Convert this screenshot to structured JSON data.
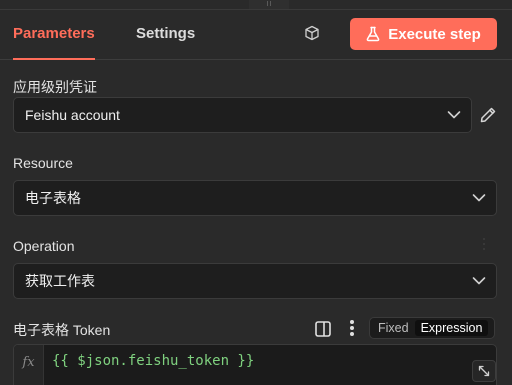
{
  "tabs": [
    {
      "label": "Parameters"
    },
    {
      "label": "Settings"
    }
  ],
  "execute_button": {
    "label": "Execute step"
  },
  "credential": {
    "label": "应用级别凭证",
    "value": "Feishu account"
  },
  "resource": {
    "label": "Resource",
    "value": "电子表格"
  },
  "operation": {
    "label": "Operation",
    "value": "获取工作表"
  },
  "token": {
    "label": "电子表格 Token",
    "mode_fixed": "Fixed",
    "mode_expression": "Expression",
    "active_mode": "Expression",
    "fx": "fx",
    "expression": "{{ $json.feishu_token }}"
  },
  "colors": {
    "accent": "#ff6d5a",
    "expression_text": "#7fd17f"
  },
  "icons": [
    "cube-icon",
    "flask-icon",
    "chevron-down-icon",
    "pencil-icon",
    "panel-icon",
    "kebab-menu-icon",
    "expand-icon"
  ]
}
